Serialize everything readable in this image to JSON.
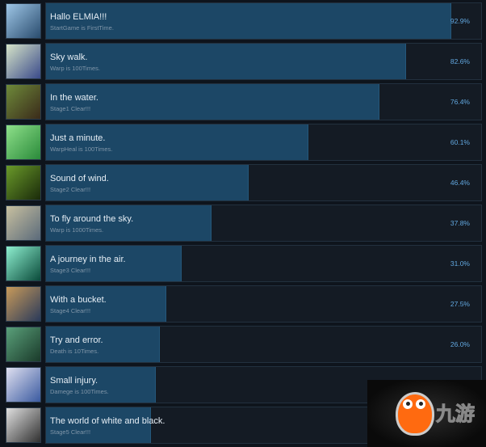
{
  "achievements": [
    {
      "title": "Hallo ELMIA!!!",
      "desc": "StartGame is FirstTime.",
      "percent": "92.9%",
      "value": 92.9,
      "icon_colors": [
        "#9ec6e6",
        "#2a4c6e"
      ]
    },
    {
      "title": "Sky walk.",
      "desc": "Warp is 100Times.",
      "percent": "82.6%",
      "value": 82.6,
      "icon_colors": [
        "#d6e4c8",
        "#3a4a8a"
      ]
    },
    {
      "title": "In the water.",
      "desc": "Stage1 Clear!!!",
      "percent": "76.4%",
      "value": 76.4,
      "icon_colors": [
        "#6e8a3a",
        "#3a2a1a"
      ]
    },
    {
      "title": "Just a minute.",
      "desc": "WarpHeal is 100Times.",
      "percent": "60.1%",
      "value": 60.1,
      "icon_colors": [
        "#8ee08a",
        "#2a8a3a"
      ]
    },
    {
      "title": "Sound of wind.",
      "desc": "Stage2 Clear!!!",
      "percent": "46.4%",
      "value": 46.4,
      "icon_colors": [
        "#6a9a2a",
        "#1a2a0a"
      ]
    },
    {
      "title": "To fly around the sky.",
      "desc": "Warp is 1000Times.",
      "percent": "37.8%",
      "value": 37.8,
      "icon_colors": [
        "#c8c0a0",
        "#5a6a7a"
      ]
    },
    {
      "title": "A journey in the air.",
      "desc": "Stage3 Clear!!!",
      "percent": "31.0%",
      "value": 31.0,
      "icon_colors": [
        "#8ef0d0",
        "#0a4a3a"
      ]
    },
    {
      "title": "With a bucket.",
      "desc": "Stage4 Clear!!!",
      "percent": "27.5%",
      "value": 27.5,
      "icon_colors": [
        "#c89a5a",
        "#2a3a5a"
      ]
    },
    {
      "title": "Try and error.",
      "desc": "Death is 10Times.",
      "percent": "26.0%",
      "value": 26.0,
      "icon_colors": [
        "#5aa07a",
        "#1a3a2a"
      ]
    },
    {
      "title": "Small injury.",
      "desc": "Damege is 100Times.",
      "percent": "",
      "value": 25.0,
      "icon_colors": [
        "#e0e0f0",
        "#3a5aa0"
      ]
    },
    {
      "title": "The world of white and black.",
      "desc": "Stage5 Clear!!!",
      "percent": "",
      "value": 24.0,
      "icon_colors": [
        "#e0e0e0",
        "#303030"
      ]
    }
  ],
  "watermark": {
    "text": "九游",
    "accent": "#ff6a10"
  }
}
